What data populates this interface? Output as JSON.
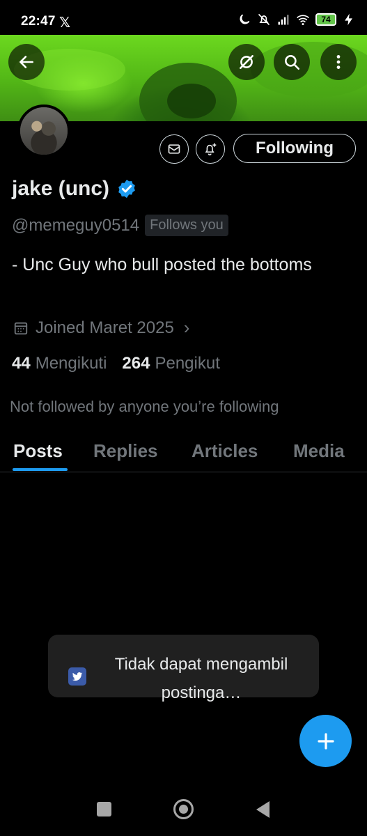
{
  "status_bar": {
    "time": "22:47",
    "app_glyph": "𝕏",
    "battery": "74",
    "icons": [
      "moon-icon",
      "mute-icon",
      "signal-icon",
      "wifi-icon",
      "battery-icon",
      "charging-icon"
    ]
  },
  "header": {
    "buttons": [
      "back-icon",
      "grok-icon",
      "search-icon",
      "more-icon"
    ]
  },
  "profile": {
    "display_name": "jake (unc)",
    "verified": true,
    "handle": "@memeguy0514",
    "follows_you": "Follows you",
    "bio": "- Unc Guy who bull posted the bottoms",
    "joined": "Joined Maret 2025",
    "following_count": "44",
    "following_label": "Mengikuti",
    "followers_count": "264",
    "followers_label": "Pengikut",
    "mutuals": "Not followed by anyone you’re following"
  },
  "actions": {
    "follow_label": "Following"
  },
  "tabs": [
    {
      "label": "Posts",
      "active": true
    },
    {
      "label": "Replies",
      "active": false
    },
    {
      "label": "Articles",
      "active": false
    },
    {
      "label": "Media",
      "active": false
    }
  ],
  "toast": {
    "message": "Tidak dapat mengambil postinga…"
  },
  "colors": {
    "accent": "#1d9bf0",
    "background": "#000000",
    "secondary_text": "#71767b",
    "primary_text": "#e7e9ea"
  }
}
